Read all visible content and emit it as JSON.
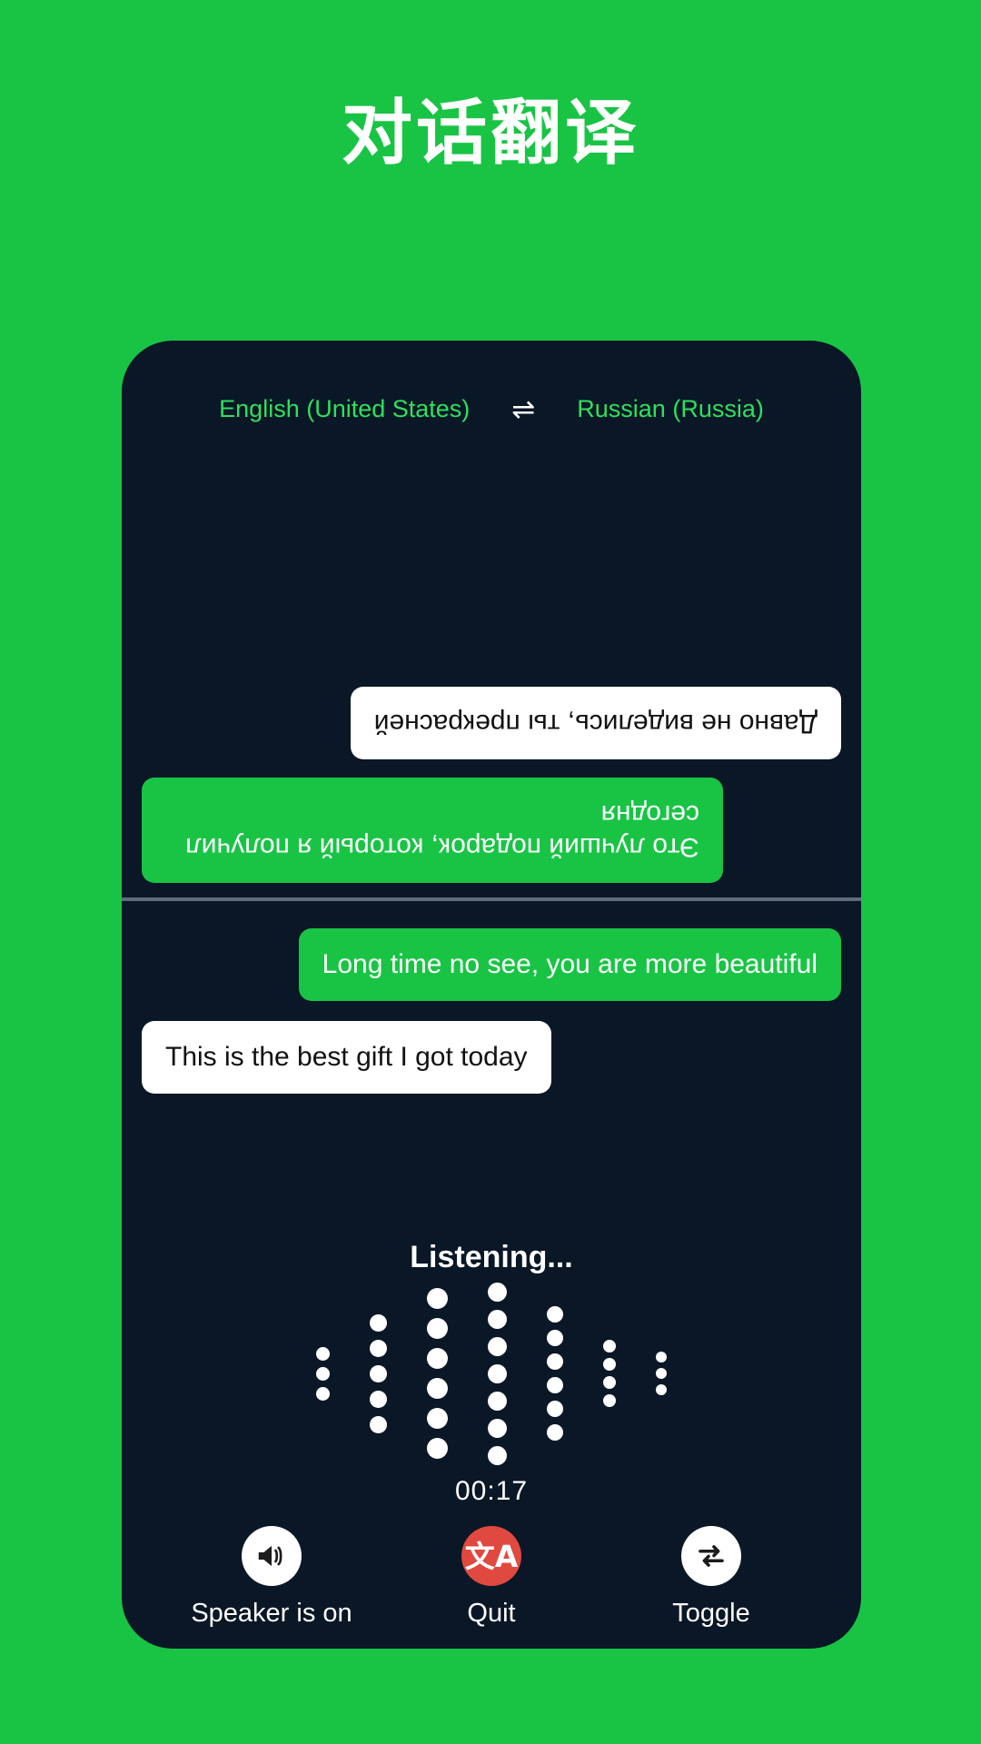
{
  "page": {
    "title": "对话翻译",
    "background_color": "#19c445",
    "panel_color": "#0a1726"
  },
  "language_bar": {
    "source_language": "English (United States)",
    "swap_icon": "swap-horizontal-icon",
    "swap_glyph": "⇌",
    "target_language": "Russian (Russia)",
    "text_color": "#2ee05d"
  },
  "conversation": {
    "remote": {
      "rotated": true,
      "bubbles": [
        {
          "text": "Это лучший подарок, который я получил сегодня",
          "style": "green",
          "align": "right"
        },
        {
          "text": "Давно не виделись, ты прекрасней",
          "style": "white",
          "align": "left"
        }
      ]
    },
    "local": {
      "bubbles": [
        {
          "text": "Long time no see, you are more beautiful",
          "style": "green",
          "align": "right"
        },
        {
          "text": "This is the best gift I got today",
          "style": "white",
          "align": "left"
        }
      ]
    }
  },
  "recorder": {
    "status_text": "Listening...",
    "timer": "00:17",
    "waveform": {
      "columns": [
        {
          "dots": 3,
          "size": 15
        },
        {
          "dots": 5,
          "size": 19
        },
        {
          "dots": 6,
          "size": 23
        },
        {
          "dots": 7,
          "size": 21
        },
        {
          "dots": 6,
          "size": 18
        },
        {
          "dots": 4,
          "size": 14
        },
        {
          "dots": 3,
          "size": 12
        }
      ],
      "dot_color": "#ffffff"
    }
  },
  "controls": [
    {
      "id": "speaker",
      "label": "Speaker is on",
      "icon": "speaker-on-icon",
      "circle_color": "#ffffff",
      "icon_color": "#1c1c1c"
    },
    {
      "id": "quit",
      "label": "Quit",
      "icon": "translate-icon",
      "glyph": "文A",
      "circle_color": "#e0493f",
      "icon_color": "#ffffff"
    },
    {
      "id": "toggle",
      "label": "Toggle",
      "icon": "swap-arrows-icon",
      "circle_color": "#ffffff",
      "icon_color": "#1c1c1c"
    }
  ]
}
